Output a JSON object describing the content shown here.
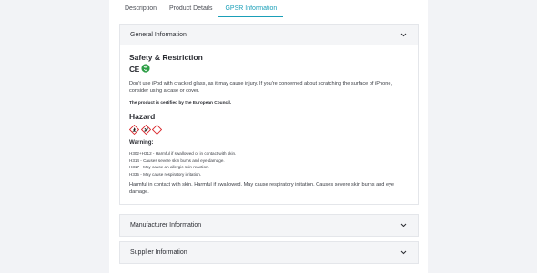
{
  "tabs": [
    {
      "label": "Description",
      "active": false
    },
    {
      "label": "Product Details",
      "active": false
    },
    {
      "label": "GPSR Information",
      "active": true
    }
  ],
  "general": {
    "header": "General Information",
    "safety_title": "Safety & Restriction",
    "marks": [
      "CE",
      "recycle-icon"
    ],
    "safety_text": "Don't use iPod with cracked glass, as it may cause injury. If you're concerned about scratching the surface of iPhone, consider using a case or cover.",
    "certified_text": "The product is certified by the European Council.",
    "hazard_title": "Hazard",
    "pictograms": [
      "flame-pictogram",
      "oxidizer-pictogram",
      "exclamation-pictogram"
    ],
    "warning_title": "Warning:",
    "hazard_statements": [
      "H302+H312 - Harmful if swallowed or in contact with skin.",
      "H314 - Causes severe skin burns and eye damage.",
      "H317 - May cause an allergic skin reaction.",
      "H335 - May cause respiratory irritation."
    ],
    "summary_text": "Harmful in contact with skin. Harmful if swallowed. May cause respiratory irritation. Causes severe skin burns and eye damage."
  },
  "manufacturer": {
    "header": "Manufacturer Information"
  },
  "supplier": {
    "header": "Supplier Information"
  },
  "colors": {
    "accent": "#1a9fb8",
    "hazard_red": "#d9262b",
    "recycle_green": "#2e9e46"
  }
}
